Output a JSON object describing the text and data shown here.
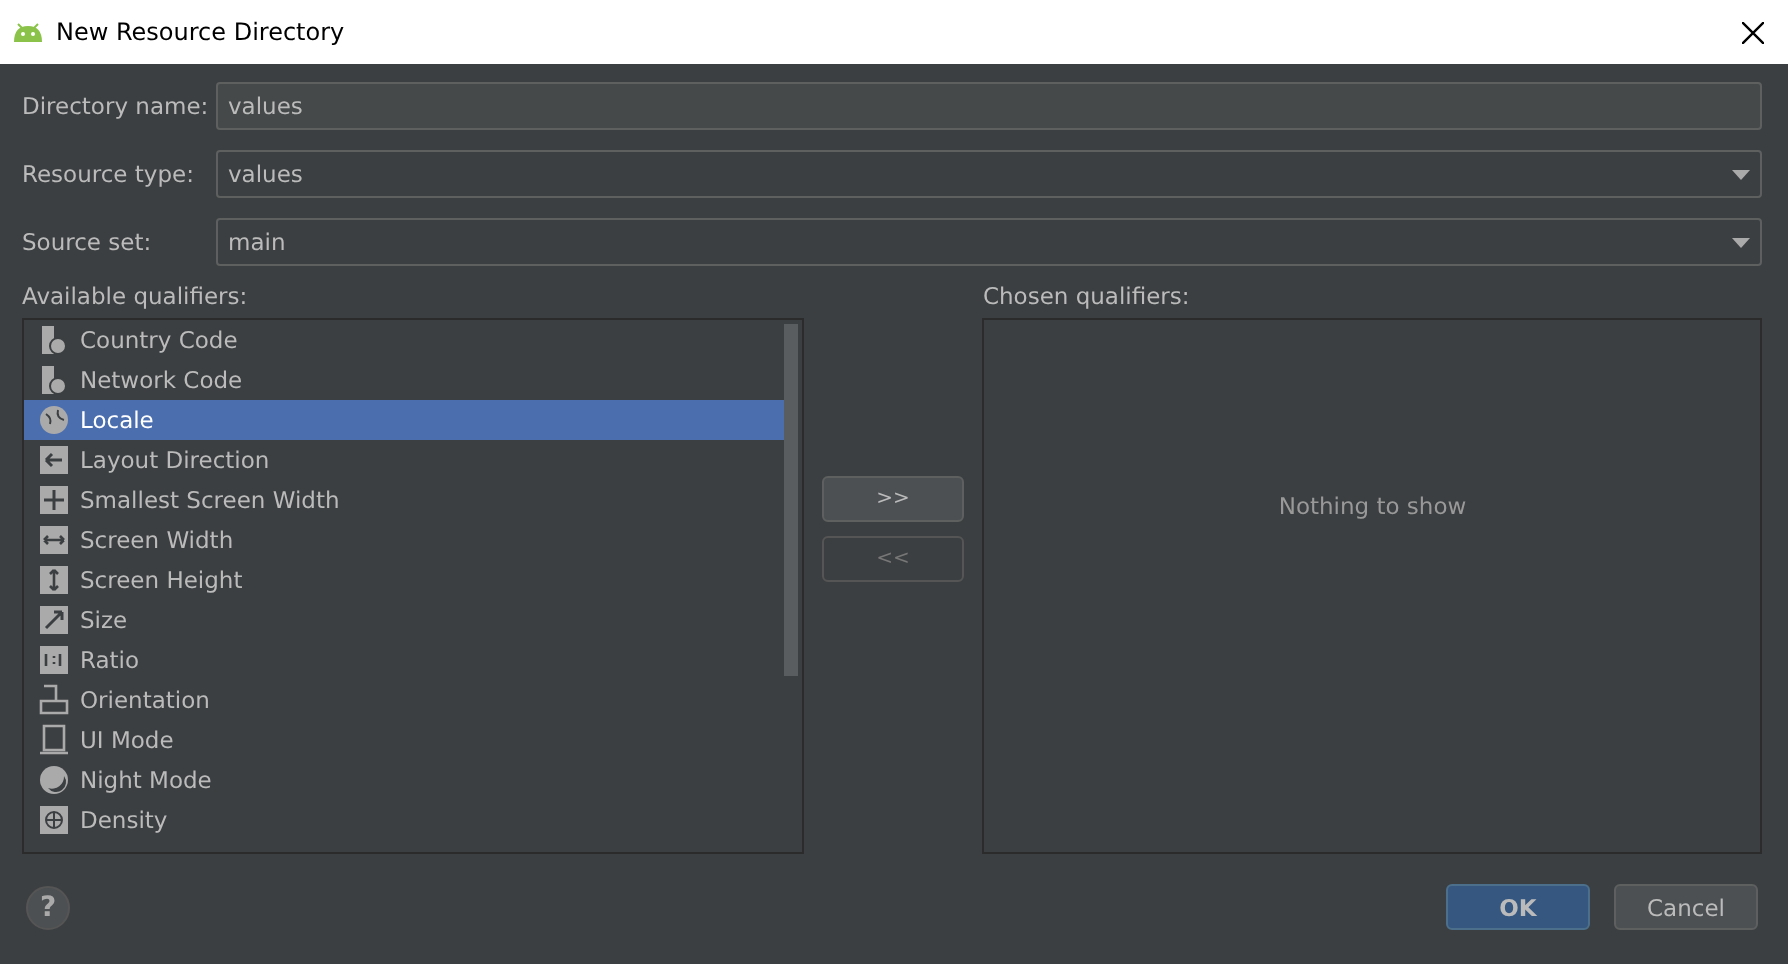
{
  "window": {
    "title": "New Resource Directory"
  },
  "fields": [
    {
      "label": "Directory name:",
      "value": "values",
      "kind": "text"
    },
    {
      "label": "Resource type:",
      "value": "values",
      "kind": "combo"
    },
    {
      "label": "Source set:",
      "value": "main",
      "kind": "combo"
    }
  ],
  "available": {
    "label": "Available qualifiers:",
    "items": [
      {
        "label": "Country Code",
        "selected": false
      },
      {
        "label": "Network Code",
        "selected": false
      },
      {
        "label": "Locale",
        "selected": true
      },
      {
        "label": "Layout Direction",
        "selected": false
      },
      {
        "label": "Smallest Screen Width",
        "selected": false
      },
      {
        "label": "Screen Width",
        "selected": false
      },
      {
        "label": "Screen Height",
        "selected": false
      },
      {
        "label": "Size",
        "selected": false
      },
      {
        "label": "Ratio",
        "selected": false
      },
      {
        "label": "Orientation",
        "selected": false
      },
      {
        "label": "UI Mode",
        "selected": false
      },
      {
        "label": "Night Mode",
        "selected": false
      },
      {
        "label": "Density",
        "selected": false
      }
    ]
  },
  "move_buttons": [
    {
      "label": ">>",
      "disabled": false
    },
    {
      "label": "<<",
      "disabled": true
    }
  ],
  "chosen": {
    "label": "Chosen qualifiers:",
    "empty_text": "Nothing to show"
  },
  "help": {
    "label": "?"
  },
  "buttons": [
    {
      "label": "OK",
      "default": true
    },
    {
      "label": "Cancel",
      "default": false
    }
  ]
}
